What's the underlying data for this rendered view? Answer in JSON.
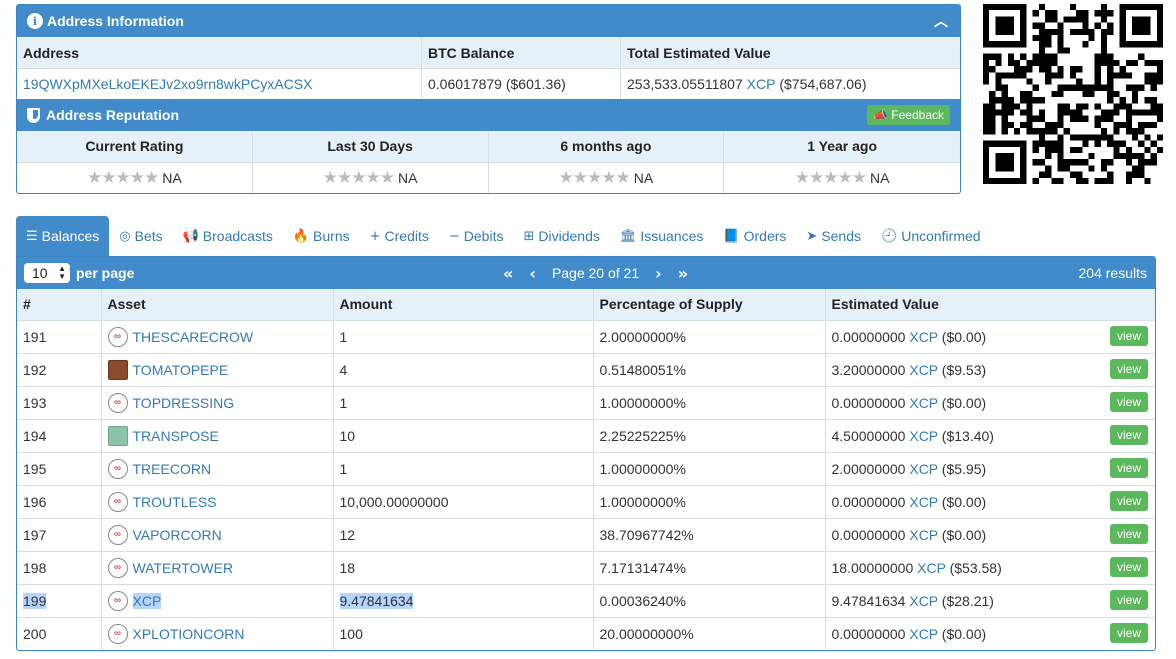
{
  "address_info": {
    "title": "Address Information",
    "headers": [
      "Address",
      "BTC Balance",
      "Total Estimated Value"
    ],
    "address": "19QWXpMXeLkoEKEJv2xo9rn8wkPCyxACSX",
    "btc_balance": "0.06017879 ($601.36)",
    "total_value_amount": "253,533.05511807",
    "total_value_asset": "XCP",
    "total_value_usd": "($754,687.06)"
  },
  "reputation": {
    "title": "Address Reputation",
    "feedback_label": "Feedback",
    "columns": [
      "Current Rating",
      "Last 30 Days",
      "6 months ago",
      "1 Year ago"
    ],
    "values": [
      "NA",
      "NA",
      "NA",
      "NA"
    ],
    "stars": "★★★★★"
  },
  "tabs": [
    {
      "label": "Balances",
      "icon": "list-icon",
      "glyph": "☰"
    },
    {
      "label": "Bets",
      "icon": "target-icon",
      "glyph": "◎"
    },
    {
      "label": "Broadcasts",
      "icon": "bullhorn-icon",
      "glyph": "📢"
    },
    {
      "label": "Burns",
      "icon": "fire-icon",
      "glyph": "🔥"
    },
    {
      "label": "Credits",
      "icon": "plus-icon",
      "glyph": "+"
    },
    {
      "label": "Debits",
      "icon": "minus-icon",
      "glyph": "−"
    },
    {
      "label": "Dividends",
      "icon": "sitemap-icon",
      "glyph": "⊞"
    },
    {
      "label": "Issuances",
      "icon": "bank-icon",
      "glyph": "🏛"
    },
    {
      "label": "Orders",
      "icon": "book-icon",
      "glyph": "📘"
    },
    {
      "label": "Sends",
      "icon": "send-icon",
      "glyph": "➤"
    },
    {
      "label": "Unconfirmed",
      "icon": "clock-icon",
      "glyph": "🕘"
    }
  ],
  "balances": {
    "per_page_value": "10",
    "per_page_label": "per page",
    "page_text": "Page 20 of 21",
    "results_text": "204 results",
    "columns": [
      "#",
      "Asset",
      "Amount",
      "Percentage of Supply",
      "Estimated Value"
    ],
    "view_label": "view",
    "rows": [
      {
        "num": "191",
        "asset": "THESCARECROW",
        "icon": "counterparty-icon",
        "amount": "1",
        "pct": "2.00000000%",
        "ev_amount": "0.00000000",
        "ev_asset": "XCP",
        "ev_usd": "($0.00)"
      },
      {
        "num": "192",
        "asset": "TOMATOPEPE",
        "icon": "tomatopepe-image-icon",
        "amount": "4",
        "pct": "0.51480051%",
        "ev_amount": "3.20000000",
        "ev_asset": "XCP",
        "ev_usd": "($9.53)"
      },
      {
        "num": "193",
        "asset": "TOPDRESSING",
        "icon": "counterparty-icon",
        "amount": "1",
        "pct": "1.00000000%",
        "ev_amount": "0.00000000",
        "ev_asset": "XCP",
        "ev_usd": "($0.00)"
      },
      {
        "num": "194",
        "asset": "TRANSPOSE",
        "icon": "transpose-image-icon",
        "amount": "10",
        "pct": "2.25225225%",
        "ev_amount": "4.50000000",
        "ev_asset": "XCP",
        "ev_usd": "($13.40)"
      },
      {
        "num": "195",
        "asset": "TREECORN",
        "icon": "counterparty-icon",
        "amount": "1",
        "pct": "1.00000000%",
        "ev_amount": "2.00000000",
        "ev_asset": "XCP",
        "ev_usd": "($5.95)"
      },
      {
        "num": "196",
        "asset": "TROUTLESS",
        "icon": "counterparty-icon",
        "amount": "10,000.00000000",
        "pct": "1.00000000%",
        "ev_amount": "0.00000000",
        "ev_asset": "XCP",
        "ev_usd": "($0.00)"
      },
      {
        "num": "197",
        "asset": "VAPORCORN",
        "icon": "counterparty-icon",
        "amount": "12",
        "pct": "38.70967742%",
        "ev_amount": "0.00000000",
        "ev_asset": "XCP",
        "ev_usd": "($0.00)"
      },
      {
        "num": "198",
        "asset": "WATERTOWER",
        "icon": "counterparty-icon",
        "amount": "18",
        "pct": "7.17131474%",
        "ev_amount": "18.00000000",
        "ev_asset": "XCP",
        "ev_usd": "($53.58)"
      },
      {
        "num": "199",
        "asset": "XCP",
        "icon": "counterparty-icon",
        "amount": "9.47841634",
        "pct": "0.00036240%",
        "ev_amount": "9.47841634",
        "ev_asset": "XCP",
        "ev_usd": "($28.21)",
        "selected": true
      },
      {
        "num": "200",
        "asset": "XPLOTIONCORN",
        "icon": "counterparty-icon",
        "amount": "100",
        "pct": "20.00000000%",
        "ev_amount": "0.00000000",
        "ev_asset": "XCP",
        "ev_usd": "($0.00)"
      }
    ]
  }
}
